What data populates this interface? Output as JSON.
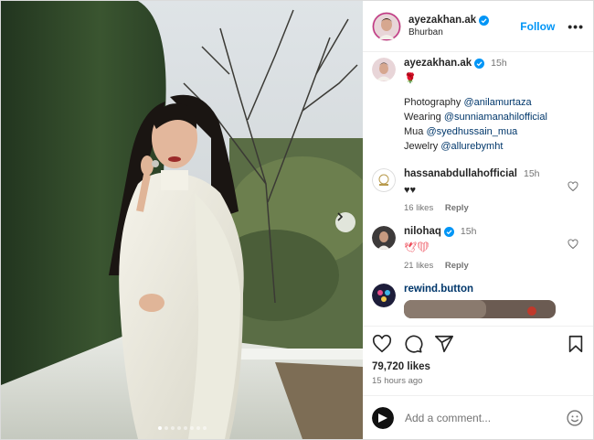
{
  "post": {
    "author": "ayezakhan.ak",
    "location": "Bhurban",
    "follow_label": "Follow",
    "more_label": "•••",
    "carousel_pages": 8,
    "carousel_active": 1
  },
  "caption": {
    "username": "ayezakhan.ak",
    "time": "15h",
    "emoji": "🌹",
    "lines": [
      {
        "prefix": "Photography ",
        "mention": "@anilamurtaza"
      },
      {
        "prefix": "Wearing ",
        "mention": "@sunniamanahilofficial"
      },
      {
        "prefix": "Mua ",
        "mention": "@syedhussain_mua"
      },
      {
        "prefix": "Jewelry ",
        "mention": "@allurebymht"
      }
    ]
  },
  "comments": [
    {
      "username": "hassanabdullahofficial",
      "verified": false,
      "time": "15h",
      "text": "♥♥",
      "likes": "16 likes",
      "reply": "Reply"
    },
    {
      "username": "nilohaq",
      "verified": true,
      "time": "15h",
      "text": "🕊❤",
      "likes": "21 likes",
      "reply": "Reply"
    },
    {
      "username": "rewind.button",
      "verified": false,
      "time": "",
      "text": "",
      "likes": "",
      "reply": ""
    }
  ],
  "stats": {
    "likes": "79,720 likes",
    "time_ago": "15 hours ago"
  },
  "composer": {
    "placeholder": "Add a comment..."
  },
  "colors": {
    "accent": "#0095f6",
    "mention": "#00376b",
    "verified": "#0095f6",
    "like_red": "#ed4956"
  }
}
